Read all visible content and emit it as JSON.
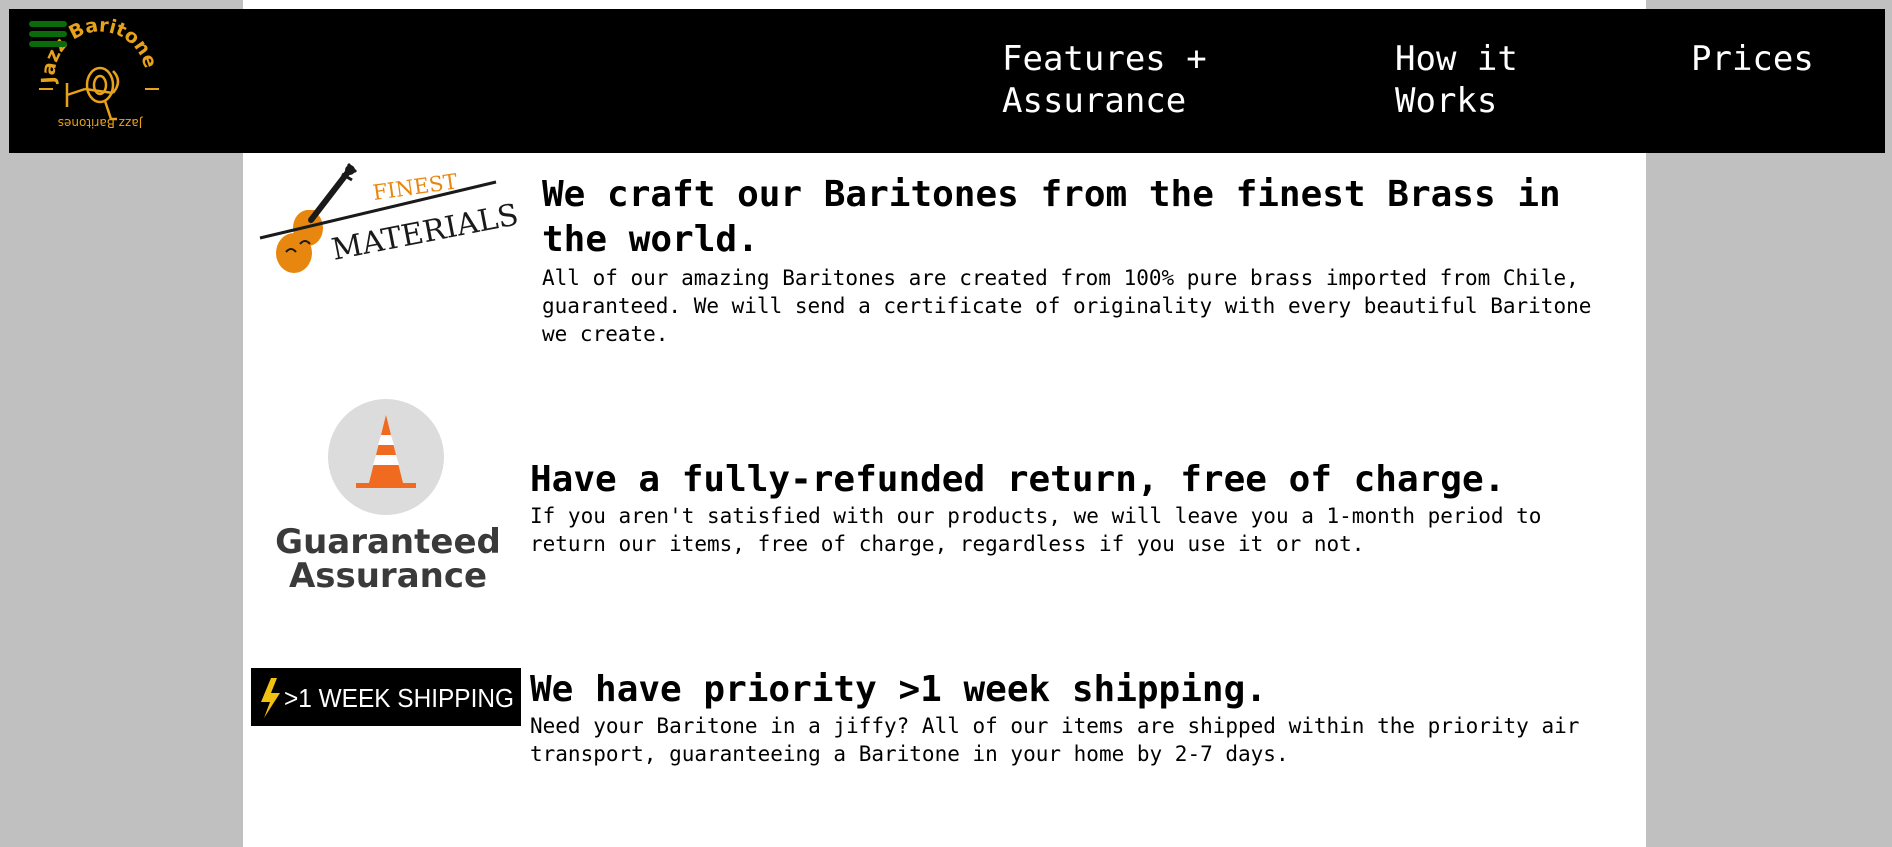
{
  "brand": {
    "logo_text_top": "Jazz Baritones",
    "logo_text_bottom": "Jazz Baritones",
    "accent_color": "#e8a21a"
  },
  "nav": {
    "menu_icon": "hamburger-menu-icon",
    "links": [
      {
        "line1": "Features +",
        "line2": "Assurance"
      },
      {
        "line1": "How it",
        "line2": "Works"
      },
      {
        "line1": "Prices",
        "line2": ""
      }
    ]
  },
  "features": [
    {
      "image": {
        "top": "FINEST",
        "bottom": "MATERIALS",
        "icon": "violin-icon"
      },
      "title": "We craft our Baritones from the finest Brass in the world.",
      "text": "All of our amazing Baritones are created from 100% pure brass imported from Chile, guaranteed. We will send a certificate of originality with every beautiful Baritone we create."
    },
    {
      "image": {
        "line1": "Guaranteed",
        "line2": "Assurance",
        "icon": "traffic-cone-icon"
      },
      "title": "Have a fully-refunded return, free of charge.",
      "text": "If you aren't satisfied with our products, we will leave you a 1-month period to return our items, free of charge, regardless if you use it or not."
    },
    {
      "image": {
        "text": ">1 WEEK SHIPPING",
        "icon": "lightning-bolt-icon"
      },
      "title": "We have priority >1 week shipping.",
      "text": "Need your Baritone in a jiffy? All of our items are shipped within the priority air transport, guaranteeing a Baritone in your home by 2-7 days."
    }
  ]
}
